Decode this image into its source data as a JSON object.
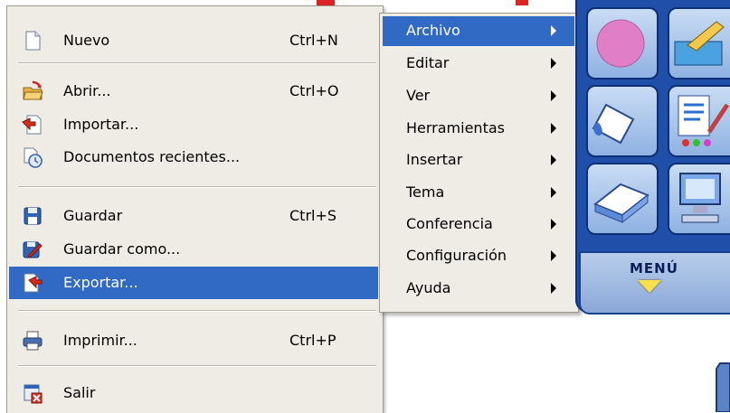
{
  "file_menu": {
    "items": [
      {
        "label": "Nuevo",
        "shortcut": "Ctrl+N",
        "icon": "new-document-icon"
      },
      {
        "label": "Abrir...",
        "shortcut": "Ctrl+O",
        "icon": "open-folder-icon"
      },
      {
        "label": "Importar...",
        "shortcut": "",
        "icon": "import-icon"
      },
      {
        "label": "Documentos recientes...",
        "shortcut": "",
        "icon": "recent-documents-icon"
      },
      {
        "label": "Guardar",
        "shortcut": "Ctrl+S",
        "icon": "save-icon"
      },
      {
        "label": "Guardar como...",
        "shortcut": "",
        "icon": "save-as-icon"
      },
      {
        "label": "Exportar...",
        "shortcut": "",
        "icon": "export-icon",
        "highlighted": true
      },
      {
        "label": "Imprimir...",
        "shortcut": "Ctrl+P",
        "icon": "print-icon"
      },
      {
        "label": "Salir",
        "shortcut": "",
        "icon": "exit-icon"
      }
    ]
  },
  "sub_menu": {
    "items": [
      {
        "label": "Archivo",
        "highlighted": true
      },
      {
        "label": "Editar"
      },
      {
        "label": "Ver"
      },
      {
        "label": "Herramientas"
      },
      {
        "label": "Insertar"
      },
      {
        "label": "Tema"
      },
      {
        "label": "Conferencia"
      },
      {
        "label": "Configuración"
      },
      {
        "label": "Ayuda"
      }
    ]
  },
  "toolbar": {
    "menu_button_label": "MENÚ",
    "tiles": [
      "pink-circle-icon",
      "toolbox-icon",
      "paint-bucket-icon",
      "edit-tools-icon",
      "eraser-icon",
      "computer-icon"
    ]
  },
  "colors": {
    "highlight": "#316ac5",
    "menu_bg": "#eeece5",
    "panel_blue": "#1f4fa8"
  }
}
